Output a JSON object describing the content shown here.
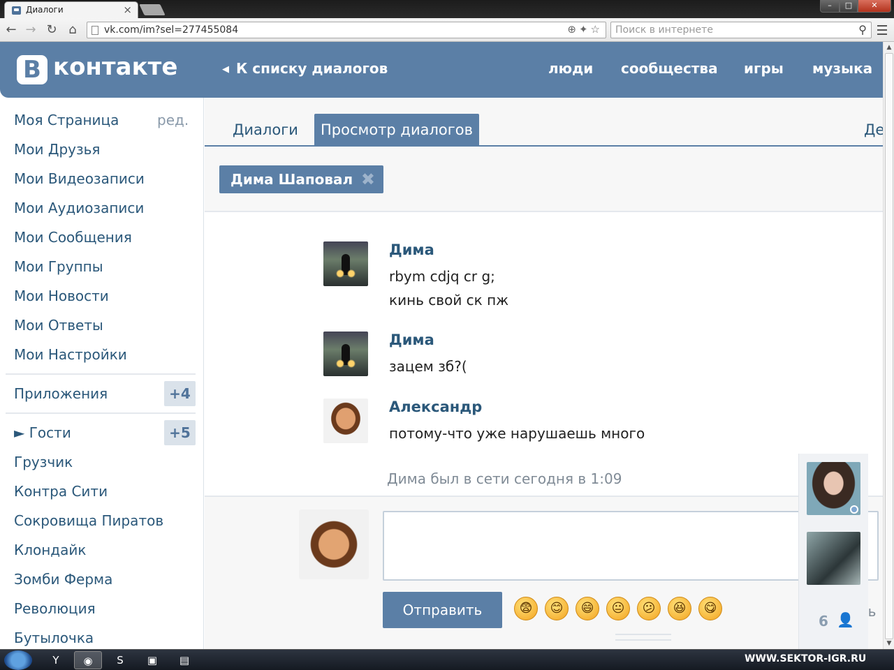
{
  "browser": {
    "tab_title": "Диалоги",
    "tab_close": "×",
    "url": "vk.com/im?sel=277455084",
    "search_placeholder": "Поиск в интернете"
  },
  "header": {
    "logo_mark": "B",
    "logo_text": "контакте",
    "back_link": "К списку диалогов",
    "nav": [
      "люди",
      "сообщества",
      "игры",
      "музыка"
    ]
  },
  "sidebar": {
    "edit_label": "ред.",
    "items": [
      "Моя Страница",
      "Мои Друзья",
      "Мои Видеозаписи",
      "Мои Аудиозаписи",
      "Мои Сообщения",
      "Мои Группы",
      "Мои Новости",
      "Мои Ответы",
      "Мои Настройки"
    ],
    "apps_label": "Приложения",
    "apps_badge": "+4",
    "guests_label": "► Гости",
    "guests_badge": "+5",
    "apps": [
      "Грузчик",
      "Контра Сити",
      "Сокровища Пиратов",
      "Клондайк",
      "Зомби Ферма",
      "Революция",
      "Бутылочка"
    ]
  },
  "tabs": {
    "dialogs": "Диалоги",
    "view": "Просмотр диалогов",
    "more": "Де"
  },
  "chip": {
    "name": "Дима Шаповал",
    "close": "✖"
  },
  "messages": [
    {
      "sender": "Дима",
      "lines": [
        "rbym cdjq cr g;",
        "кинь свой ск пж"
      ]
    },
    {
      "sender": "Дима",
      "lines": [
        "зацем зб?("
      ]
    },
    {
      "sender": "Александр",
      "lines": [
        "потому-что уже нарушаешь много"
      ]
    }
  ],
  "last_seen": "Дима был в сети сегодня в 1:09",
  "composer": {
    "send_label": "Отправить",
    "emojis": [
      "😨",
      "😊",
      "😄",
      "😐",
      "😕",
      "😆",
      "😋"
    ],
    "cut_text": "ть"
  },
  "friends_panel": {
    "count": "6"
  },
  "taskbar": {
    "watermark": "WWW.SEKTOR-IGR.RU"
  },
  "colors": {
    "vk_blue": "#5b7fa6",
    "link": "#2b587a",
    "muted": "#808b96"
  }
}
